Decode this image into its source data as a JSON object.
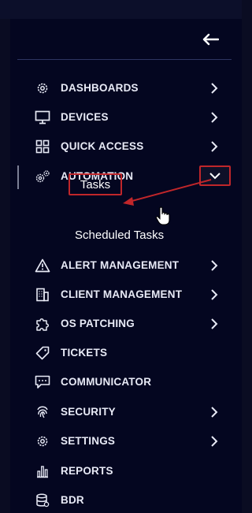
{
  "colors": {
    "annotation": "#c0262a",
    "text": "#e8eaf6",
    "background": "#040620"
  },
  "header": {
    "back_icon": "arrow-left-icon"
  },
  "menu": [
    {
      "label": "DASHBOARDS",
      "icon": "gear-icon",
      "has_chevron": true
    },
    {
      "label": "DEVICES",
      "icon": "monitor-icon",
      "has_chevron": true
    },
    {
      "label": "QUICK ACCESS",
      "icon": "grid-icon",
      "has_chevron": true
    },
    {
      "label": "AUTOMATION",
      "icon": "gears-icon",
      "has_chevron": true,
      "expanded": true
    },
    {
      "label": "ALERT MANAGEMENT",
      "icon": "warning-icon",
      "has_chevron": true
    },
    {
      "label": "CLIENT MANAGEMENT",
      "icon": "building-icon",
      "has_chevron": true
    },
    {
      "label": "OS PATCHING",
      "icon": "puzzle-icon",
      "has_chevron": true
    },
    {
      "label": "TICKETS",
      "icon": "tag-icon",
      "has_chevron": false
    },
    {
      "label": "COMMUNICATOR",
      "icon": "chat-icon",
      "has_chevron": false
    },
    {
      "label": "SECURITY",
      "icon": "fingerprint-icon",
      "has_chevron": true
    },
    {
      "label": "SETTINGS",
      "icon": "gear-icon",
      "has_chevron": true
    },
    {
      "label": "REPORTS",
      "icon": "bar-chart-icon",
      "has_chevron": false
    },
    {
      "label": "BDR",
      "icon": "database-icon",
      "has_chevron": false
    }
  ],
  "automation_submenu": [
    {
      "label": "Tasks",
      "highlighted": true
    },
    {
      "label": "Scheduled Tasks",
      "highlighted": false
    }
  ],
  "annotation": {
    "type": "arrow",
    "from": "chevron-down-icon",
    "to": "submenu-tasks"
  },
  "cursor": "hand-pointer-icon"
}
